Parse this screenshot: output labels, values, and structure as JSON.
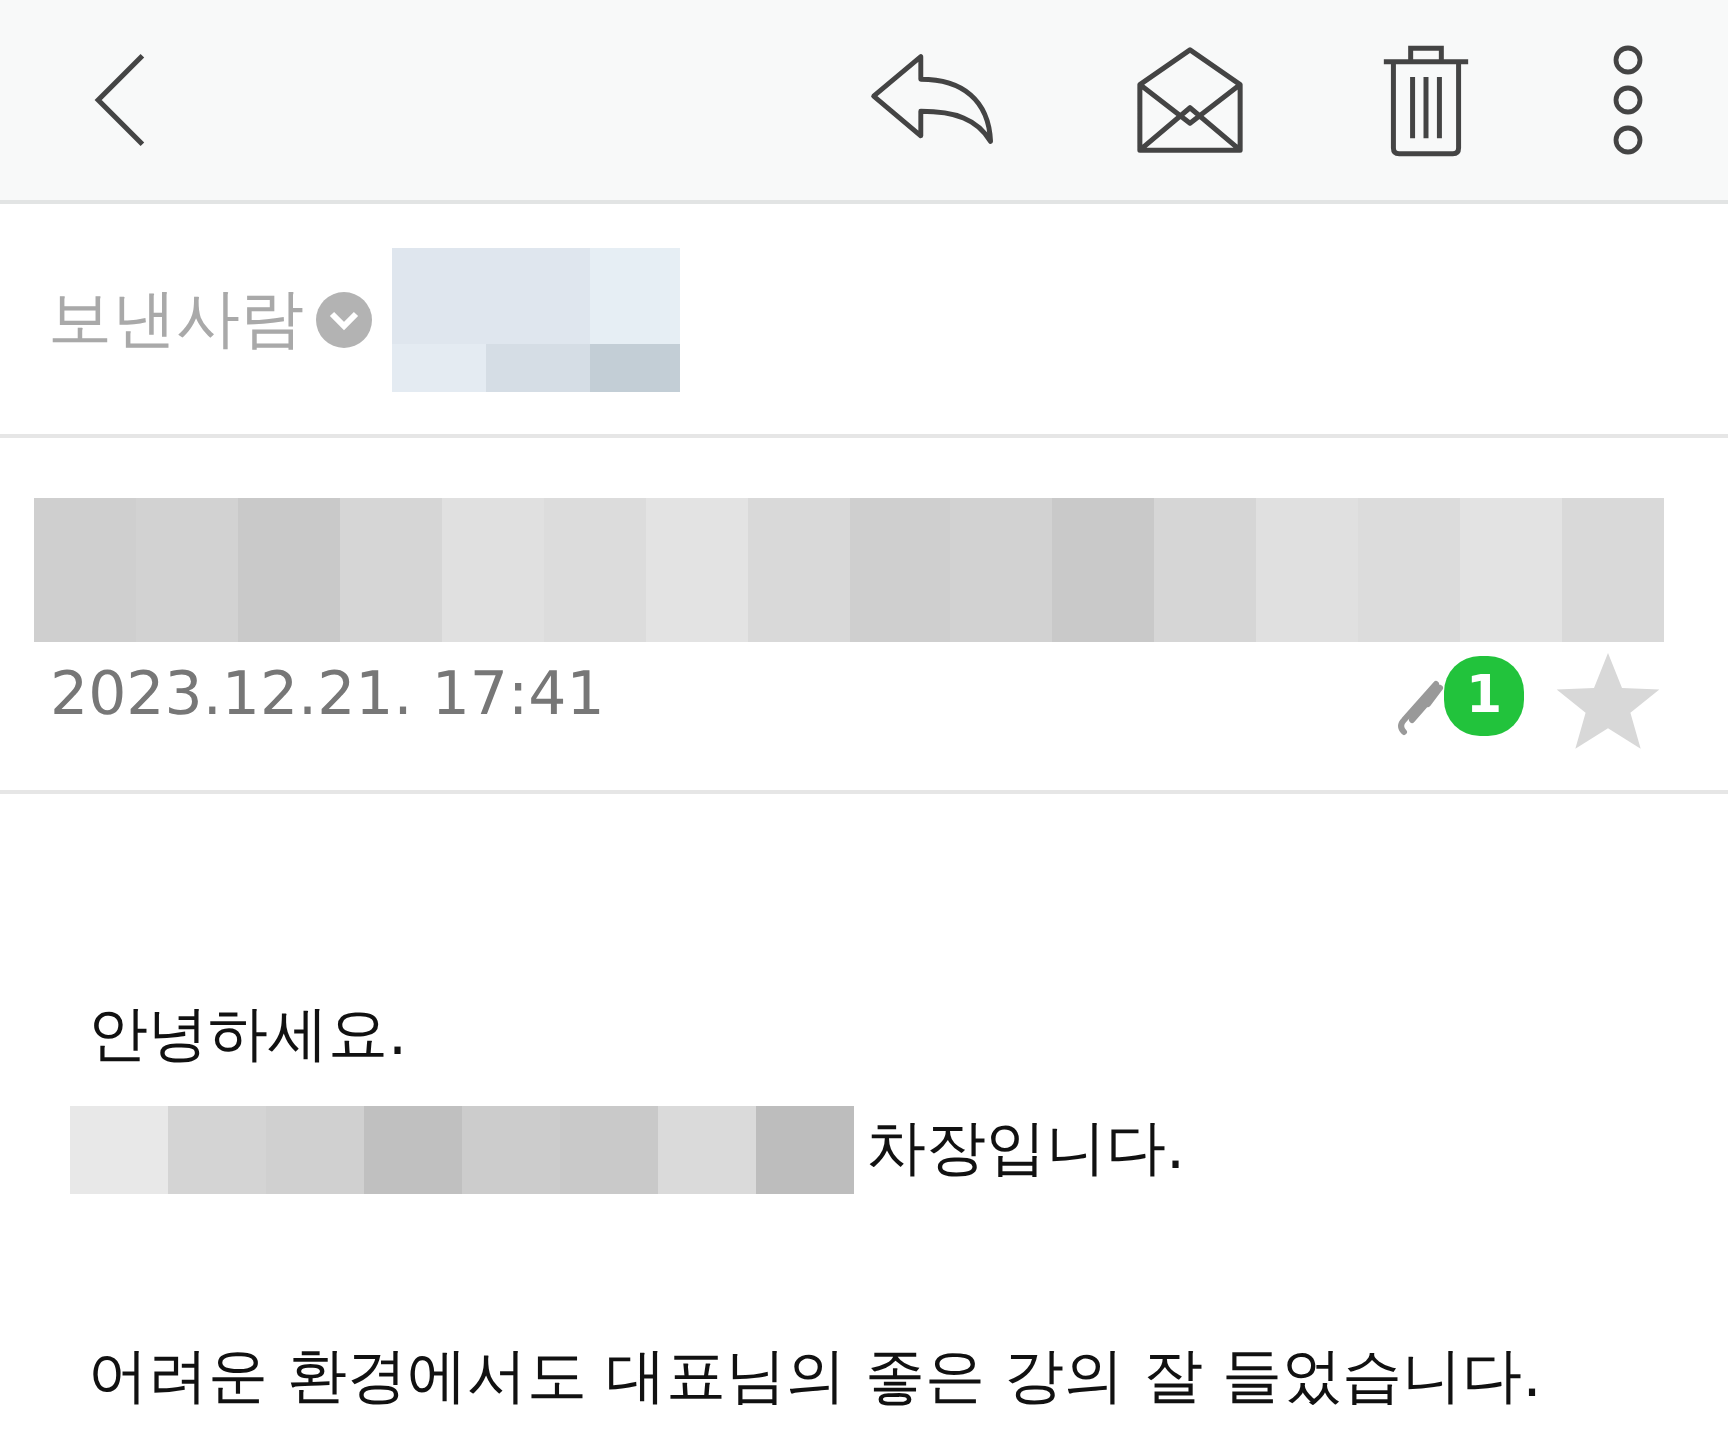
{
  "toolbar": {
    "actions": [
      {
        "kind": "reply"
      },
      {
        "kind": "envelope"
      },
      {
        "kind": "delete"
      },
      {
        "kind": "more"
      }
    ]
  },
  "sender": {
    "label": "보낸사람"
  },
  "meta": {
    "date": "2023.12.21. 17:41",
    "attachments": "1",
    "starred": false
  },
  "body": {
    "lines": [
      {
        "kind": "text",
        "text": "안녕하세요."
      },
      {
        "kind": "redacted-prefix",
        "text": "차장입니다."
      },
      {
        "kind": "blank"
      },
      {
        "kind": "text",
        "text": "어려운 환경에서도 대표님의 좋은 강의 잘 들었습니다."
      }
    ]
  }
}
